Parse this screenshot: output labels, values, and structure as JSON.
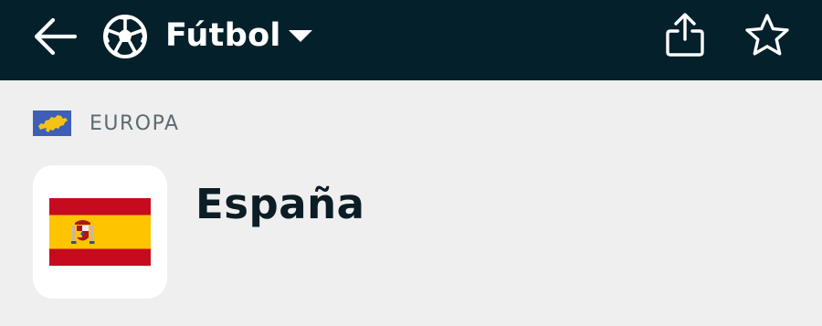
{
  "header": {
    "back_icon": "back-arrow-icon",
    "sport_icon": "soccer-ball-icon",
    "sport_title": "Fútbol",
    "dropdown_icon": "caret-down-icon",
    "share_icon": "share-icon",
    "favorite_icon": "star-outline-icon",
    "background_color": "#03202b"
  },
  "breadcrumb": {
    "region_flag_icon": "europe-flag-icon",
    "region_name": "EUROPA"
  },
  "team": {
    "flag_icon": "spain-flag-icon",
    "name": "España"
  },
  "colors": {
    "page_background": "#efefef",
    "spain_red": "#c60b1e",
    "spain_yellow": "#ffc400",
    "europe_blue": "#3d5fb8",
    "europe_yellow": "#f3c315"
  }
}
